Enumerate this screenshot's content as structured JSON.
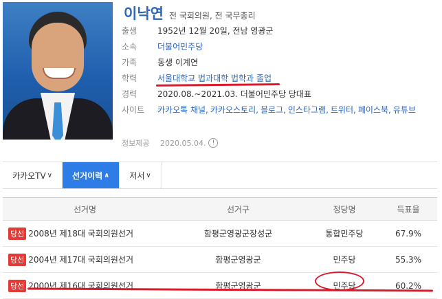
{
  "profile": {
    "name": "이낙연",
    "subtitle": "전 국회의원, 전 국무총리",
    "fields": [
      {
        "label": "출생",
        "value": "1952년 12월 20일, 전남 영광군",
        "link": false
      },
      {
        "label": "소속",
        "value": "더불어민주당",
        "link": true
      },
      {
        "label": "가족",
        "value": "동생 이계연",
        "link": false
      },
      {
        "label": "학력",
        "value": "서울대학교 법과대학 법학과 졸업",
        "link": true
      },
      {
        "label": "경력",
        "value": "2020.08.~2021.03. 더불어민주당 당대표",
        "link": false
      }
    ],
    "site_label": "사이트",
    "sites": [
      "카카오톡 채널,",
      "카카오스토리,",
      "블로그,",
      "인스타그램,",
      "트위터,",
      "페이스북,",
      "유튜브"
    ],
    "provided_label": "정보제공",
    "provided_date": "2020.05.04.",
    "info_icon": "!"
  },
  "tabs": [
    {
      "label": "카카오TV",
      "chevron": "∨",
      "active": false
    },
    {
      "label": "선거이력",
      "chevron": "∧",
      "active": true
    },
    {
      "label": "저서",
      "chevron": "∨",
      "active": false
    }
  ],
  "table": {
    "headers": [
      "선거명",
      "선거구",
      "정당명",
      "득표율"
    ],
    "rows": [
      {
        "badge": "당선",
        "election": "2008년 제18대 국회의원선거",
        "district": "함평군영광군장성군",
        "party": "통합민주당",
        "rate": "67.9%"
      },
      {
        "badge": "당선",
        "election": "2004년 제17대 국회의원선거",
        "district": "함평군영광군",
        "party": "민주당",
        "rate": "55.3%"
      },
      {
        "badge": "당선",
        "election": "2000년 제16대 국회의원선거",
        "district": "함평군영광군",
        "party": "민주당",
        "rate": "60.2%"
      }
    ]
  },
  "colors": {
    "accent": "#2e7ce6",
    "badge": "#e53935",
    "annotation": "#d81a2a"
  }
}
